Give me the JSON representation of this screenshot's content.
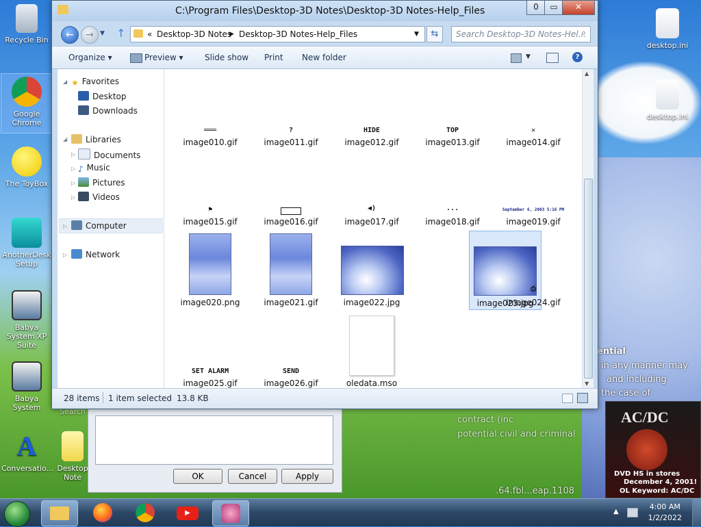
{
  "window": {
    "title": "C:\\Program Files\\Desktop-3D Notes\\Desktop-3D Notes-Help_Files",
    "minimize": "0",
    "maximize": "▭",
    "close": "✕"
  },
  "address": {
    "overflow": "«",
    "crumbs": [
      "Desktop-3D Notes",
      "Desktop-3D Notes-Help_Files"
    ],
    "search_placeholder": "Search Desktop-3D Notes-Hel..."
  },
  "toolbar": {
    "organize": "Organize",
    "preview": "Preview",
    "slideshow": "Slide show",
    "print": "Print",
    "new_folder": "New folder"
  },
  "nav": {
    "favorites": "Favorites",
    "desktop": "Desktop",
    "downloads": "Downloads",
    "libraries": "Libraries",
    "documents": "Documents",
    "music": "Music",
    "pictures": "Pictures",
    "videos": "Videos",
    "computer": "Computer",
    "network": "Network"
  },
  "files": {
    "row1": [
      "image010.gif",
      "image011.gif",
      "image012.gif",
      "image013.gif",
      "image014.gif"
    ],
    "row1_glyphs": [
      "═══",
      "?",
      "HIDE",
      "TOP",
      "✕"
    ],
    "row2": [
      "image015.gif",
      "image016.gif",
      "image017.gif",
      "image018.gif",
      "image019.gif"
    ],
    "row2_glyphs": [
      "⚑",
      "",
      "◀)",
      "...",
      "September 6, 2003 5:16 PM"
    ],
    "row3": [
      "image020.png",
      "image021.gif",
      "image022.jpg",
      "image023.jpg",
      "image024.gif"
    ],
    "row3_glyph5": "⎙",
    "row4": [
      "image025.gif",
      "image026.gif",
      "oledata.mso"
    ],
    "row4_glyphs": [
      "SET ALARM",
      "SEND"
    ]
  },
  "status": {
    "count": "28 items",
    "selected": "1 item selected",
    "size": "13.8 KB"
  },
  "dialog": {
    "ok": "OK",
    "cancel": "Cancel",
    "apply": "Apply"
  },
  "desktop_icons": {
    "recycle": "Recycle Bin",
    "chrome": "Google Chrome",
    "toybox": "The ToyBox",
    "anotherdesk": "AnotherDesk Setup",
    "babya1": "Babya System XP Suite",
    "babya2": "Babya System",
    "search_partial": "Search",
    "conversation": "Conversatio...",
    "desktopnotes": "Desktop Note",
    "ini1": "desktop.ini",
    "ini2": "desktop.ini"
  },
  "desktop_text": {
    "line1": "ential",
    "line2": "in any manner may",
    "line3": "and including",
    "line4": "the case of",
    "line5": "contract (inc",
    "line6": "potential civil and criminal",
    "line7": ".64.fbl...eap.1108",
    "acdc_title": "AC/DC",
    "acdc_line1": "DVD    HS in stores",
    "acdc_line2": "December 4, 2001!",
    "acdc_line3": "OL Keyword: AC/DC"
  },
  "taskbar": {
    "time": "4:00 AM",
    "date": "1/2/2022"
  }
}
